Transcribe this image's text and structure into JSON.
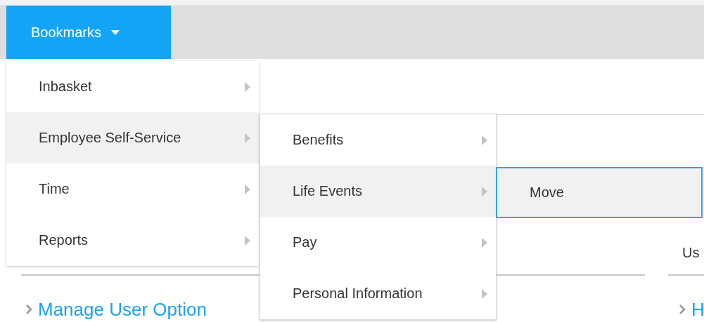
{
  "nav": {
    "bookmarks_button": {
      "label": "Bookmarks",
      "selected": true
    }
  },
  "menus": [
    {
      "items": [
        {
          "label": "Inbasket",
          "has_submenu": true,
          "selected": false
        },
        {
          "label": "Employee Self-Service",
          "has_submenu": true,
          "selected": true
        },
        {
          "label": "Time",
          "has_submenu": true,
          "selected": false
        },
        {
          "label": "Reports",
          "has_submenu": true,
          "selected": false
        }
      ]
    },
    {
      "items": [
        {
          "label": "Benefits",
          "has_submenu": true,
          "selected": false
        },
        {
          "label": "Life Events",
          "has_submenu": true,
          "selected": true
        },
        {
          "label": "Pay",
          "has_submenu": true,
          "selected": false
        },
        {
          "label": "Personal Information",
          "has_submenu": true,
          "selected": false
        }
      ]
    },
    {
      "items": [
        {
          "label": "Move",
          "has_submenu": false,
          "selected": true
        }
      ]
    }
  ],
  "panels": [
    {
      "link": "Manage User Option"
    },
    {
      "heading": "Us",
      "link": "H"
    }
  ]
}
